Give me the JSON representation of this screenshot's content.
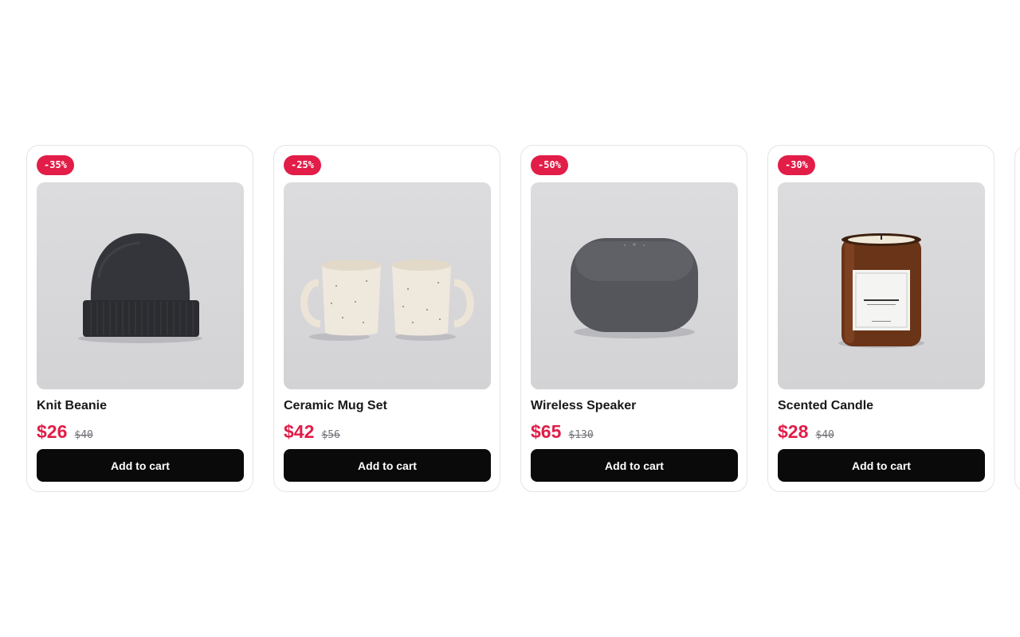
{
  "products": [
    {
      "discount": "-35%",
      "name": "Knit Beanie",
      "price": "$26",
      "old_price": "$40",
      "cta": "Add to cart",
      "image_icon": "beanie-icon"
    },
    {
      "discount": "-25%",
      "name": "Ceramic Mug Set",
      "price": "$42",
      "old_price": "$56",
      "cta": "Add to cart",
      "image_icon": "mug-set-icon"
    },
    {
      "discount": "-50%",
      "name": "Wireless Speaker",
      "price": "$65",
      "old_price": "$130",
      "cta": "Add to cart",
      "image_icon": "speaker-icon"
    },
    {
      "discount": "-30%",
      "name": "Scented Candle",
      "price": "$28",
      "old_price": "$40",
      "cta": "Add to cart",
      "image_icon": "candle-icon"
    }
  ],
  "colors": {
    "accent": "#e11d48",
    "button_bg": "#0a0a0a",
    "card_border": "#e4e4e7",
    "image_bg": "#d8d8db"
  }
}
